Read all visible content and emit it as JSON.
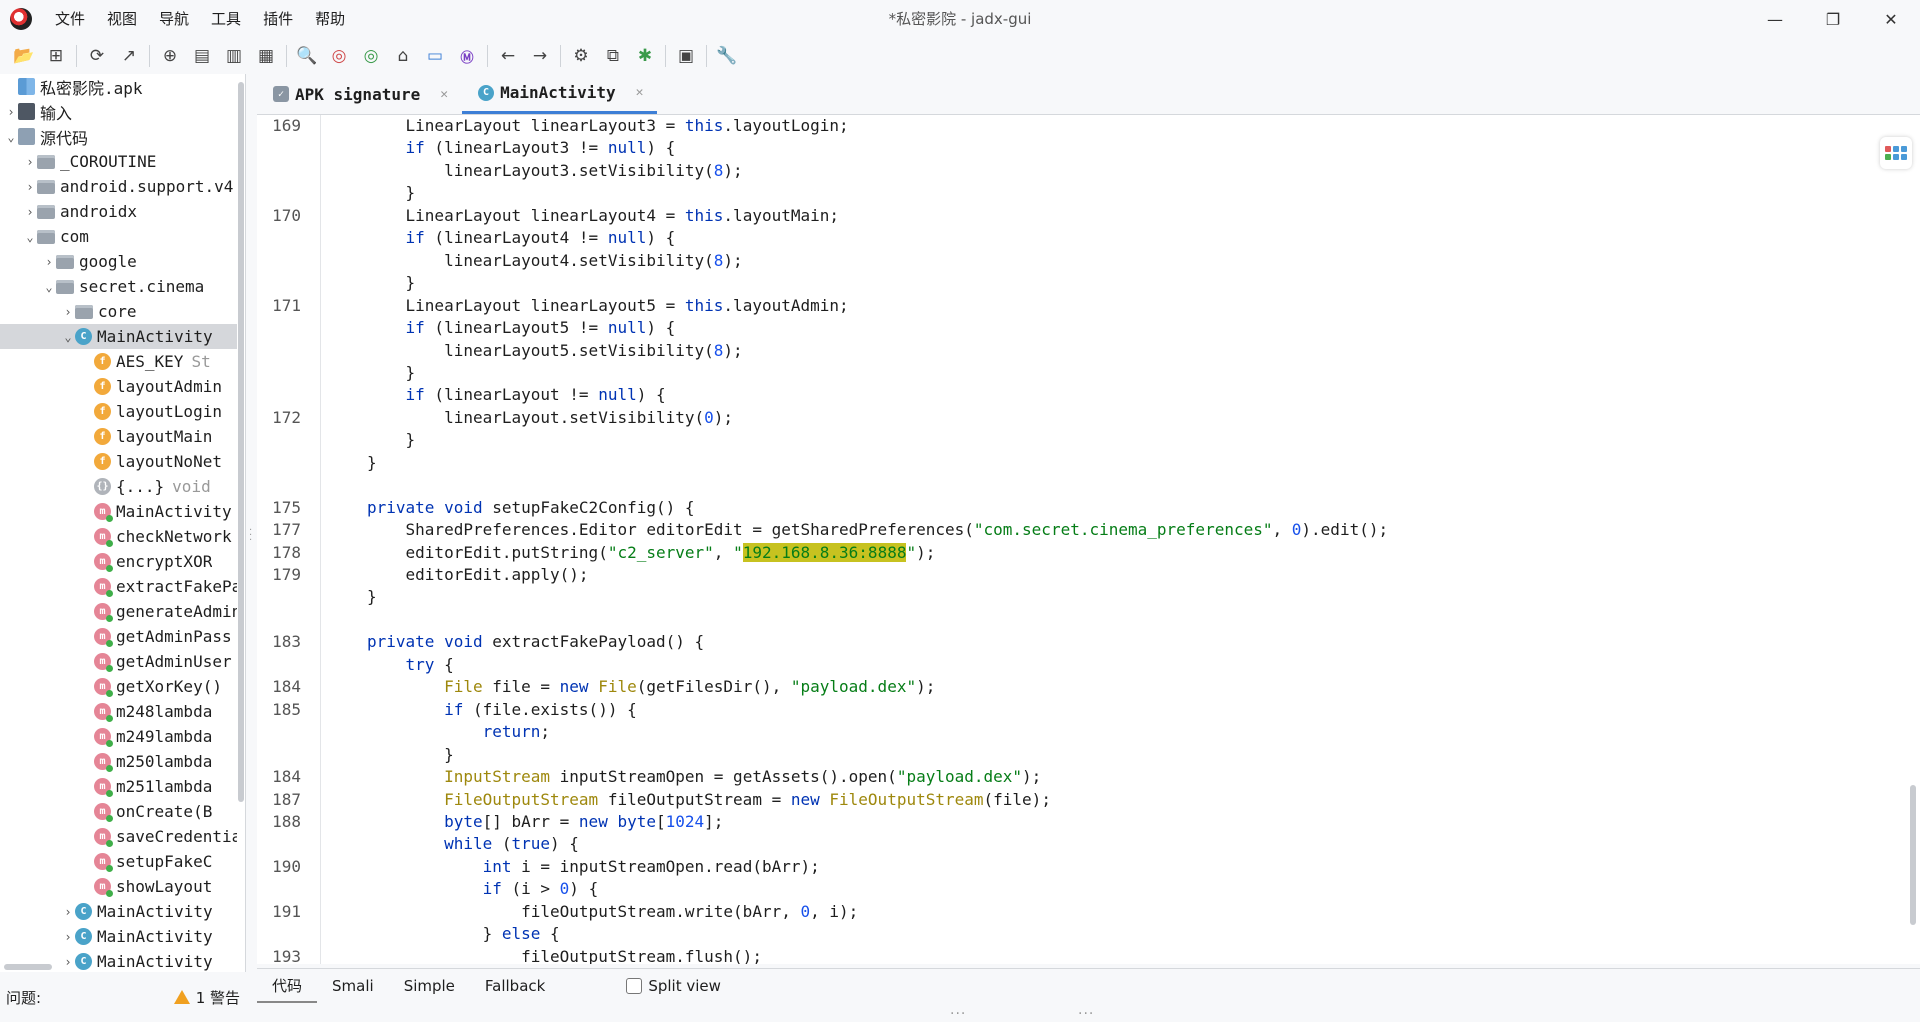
{
  "app": {
    "window_title": "*私密影院 - jadx-gui",
    "menu": [
      "文件",
      "视图",
      "导航",
      "工具",
      "插件",
      "帮助"
    ],
    "window_buttons": [
      "—",
      "❐",
      "✕"
    ]
  },
  "toolbar": {
    "icons": [
      "open-folder-icon",
      "add-files-icon",
      "reload-icon",
      "export-icon",
      "sync-tree-icon",
      "flatten-packages-icon",
      "preview-tab-icon",
      "deobfuscation-icon",
      "search-icon",
      "class-search-icon",
      "usage-search-icon",
      "home-icon",
      "log-viewer-icon",
      "smali-icon",
      "back-icon",
      "forward-icon",
      "decompile-all-icon",
      "quark-icon",
      "debugger-icon",
      "settings-dialog-icon",
      "preferences-icon"
    ]
  },
  "tree": {
    "items": [
      {
        "depth": 0,
        "chevron": "",
        "icon": "apk",
        "label": "私密影院.apk",
        "sub": ""
      },
      {
        "depth": 0,
        "chevron": "›",
        "icon": "res",
        "label": "输入",
        "sub": ""
      },
      {
        "depth": 0,
        "chevron": "⌄",
        "icon": "src",
        "label": "源代码",
        "sub": ""
      },
      {
        "depth": 1,
        "chevron": "›",
        "icon": "pkg",
        "label": "_COROUTINE",
        "sub": ""
      },
      {
        "depth": 1,
        "chevron": "›",
        "icon": "pkg",
        "label": "android.support.v4",
        "sub": ""
      },
      {
        "depth": 1,
        "chevron": "›",
        "icon": "pkg",
        "label": "androidx",
        "sub": ""
      },
      {
        "depth": 1,
        "chevron": "⌄",
        "icon": "pkg",
        "label": "com",
        "sub": ""
      },
      {
        "depth": 2,
        "chevron": "›",
        "icon": "pkg",
        "label": "google",
        "sub": ""
      },
      {
        "depth": 2,
        "chevron": "⌄",
        "icon": "pkg",
        "label": "secret.cinema",
        "sub": ""
      },
      {
        "depth": 3,
        "chevron": "›",
        "icon": "pkg",
        "label": "core",
        "sub": ""
      },
      {
        "depth": 3,
        "chevron": "⌄",
        "icon": "class",
        "label": "MainActivity",
        "sub": "",
        "selected": true
      },
      {
        "depth": 4,
        "chevron": "",
        "icon": "field",
        "label": "AES_KEY",
        "sub": "St"
      },
      {
        "depth": 4,
        "chevron": "",
        "icon": "field",
        "label": "layoutAdmin",
        "sub": ""
      },
      {
        "depth": 4,
        "chevron": "",
        "icon": "field",
        "label": "layoutLogin",
        "sub": ""
      },
      {
        "depth": 4,
        "chevron": "",
        "icon": "field",
        "label": "layoutMain",
        "sub": ""
      },
      {
        "depth": 4,
        "chevron": "",
        "icon": "field",
        "label": "layoutNoNet",
        "sub": ""
      },
      {
        "depth": 4,
        "chevron": "",
        "icon": "block",
        "label": "{...}",
        "sub": "void"
      },
      {
        "depth": 4,
        "chevron": "",
        "icon": "method",
        "label": "MainActivity",
        "sub": ""
      },
      {
        "depth": 4,
        "chevron": "",
        "icon": "method",
        "label": "checkNetwork",
        "sub": ""
      },
      {
        "depth": 4,
        "chevron": "",
        "icon": "method",
        "label": "encryptXOR",
        "sub": ""
      },
      {
        "depth": 4,
        "chevron": "",
        "icon": "method",
        "label": "extractFakePayload",
        "sub": ""
      },
      {
        "depth": 4,
        "chevron": "",
        "icon": "method",
        "label": "generateAdmin",
        "sub": ""
      },
      {
        "depth": 4,
        "chevron": "",
        "icon": "method",
        "label": "getAdminPass",
        "sub": ""
      },
      {
        "depth": 4,
        "chevron": "",
        "icon": "method",
        "label": "getAdminUser",
        "sub": ""
      },
      {
        "depth": 4,
        "chevron": "",
        "icon": "method",
        "label": "getXorKey()",
        "sub": ""
      },
      {
        "depth": 4,
        "chevron": "",
        "icon": "method",
        "label": "m248lambda",
        "sub": ""
      },
      {
        "depth": 4,
        "chevron": "",
        "icon": "method",
        "label": "m249lambda",
        "sub": ""
      },
      {
        "depth": 4,
        "chevron": "",
        "icon": "method",
        "label": "m250lambda",
        "sub": ""
      },
      {
        "depth": 4,
        "chevron": "",
        "icon": "method",
        "label": "m251lambda",
        "sub": ""
      },
      {
        "depth": 4,
        "chevron": "",
        "icon": "method",
        "label": "onCreate(B",
        "sub": ""
      },
      {
        "depth": 4,
        "chevron": "",
        "icon": "method",
        "label": "saveCredentials",
        "sub": ""
      },
      {
        "depth": 4,
        "chevron": "",
        "icon": "method",
        "label": "setupFakeC",
        "sub": ""
      },
      {
        "depth": 4,
        "chevron": "",
        "icon": "method",
        "label": "showLayout",
        "sub": ""
      },
      {
        "depth": 3,
        "chevron": "›",
        "icon": "class",
        "label": "MainActivity",
        "sub": ""
      },
      {
        "depth": 3,
        "chevron": "›",
        "icon": "class",
        "label": "MainActivity",
        "sub": ""
      },
      {
        "depth": 3,
        "chevron": "›",
        "icon": "class",
        "label": "MainActivity",
        "sub": ""
      }
    ]
  },
  "status": {
    "problems_label": "问题:",
    "warning_text": "1 警告"
  },
  "tabs": [
    {
      "label": "APK signature",
      "icon": "apk-signature-icon",
      "active": false
    },
    {
      "label": "MainActivity",
      "icon": "class-icon",
      "active": true
    }
  ],
  "code_lines": [
    {
      "ln": "169",
      "html": "    LinearLayout linearLayout3 = <span class=\"kw\">this</span>.layoutLogin;"
    },
    {
      "ln": "",
      "html": "    <span class=\"kw\">if</span> (linearLayout3 != <span class=\"kw\">null</span>) {"
    },
    {
      "ln": "",
      "html": "        linearLayout3.setVisibility(<span class=\"nm\">8</span>);"
    },
    {
      "ln": "",
      "html": "    }"
    },
    {
      "ln": "170",
      "html": "    LinearLayout linearLayout4 = <span class=\"kw\">this</span>.layoutMain;"
    },
    {
      "ln": "",
      "html": "    <span class=\"kw\">if</span> (linearLayout4 != <span class=\"kw\">null</span>) {"
    },
    {
      "ln": "",
      "html": "        linearLayout4.setVisibility(<span class=\"nm\">8</span>);"
    },
    {
      "ln": "",
      "html": "    }"
    },
    {
      "ln": "171",
      "html": "    LinearLayout linearLayout5 = <span class=\"kw\">this</span>.layoutAdmin;"
    },
    {
      "ln": "",
      "html": "    <span class=\"kw\">if</span> (linearLayout5 != <span class=\"kw\">null</span>) {"
    },
    {
      "ln": "",
      "html": "        linearLayout5.setVisibility(<span class=\"nm\">8</span>);"
    },
    {
      "ln": "",
      "html": "    }"
    },
    {
      "ln": "",
      "html": "    <span class=\"kw\">if</span> (linearLayout != <span class=\"kw\">null</span>) {"
    },
    {
      "ln": "172",
      "html": "        linearLayout.setVisibility(<span class=\"nm\">0</span>);"
    },
    {
      "ln": "",
      "html": "    }"
    },
    {
      "ln": "",
      "html": "}"
    },
    {
      "ln": "",
      "html": ""
    },
    {
      "ln": "175",
      "html": "<span class=\"kw\">private void</span> setupFakeC2Config() {"
    },
    {
      "ln": "177",
      "html": "    SharedPreferences.Editor editorEdit = getSharedPreferences(<span class=\"st\">\"com.secret.cinema_preferences\"</span>, <span class=\"nm\">0</span>).edit();"
    },
    {
      "ln": "178",
      "html": "    editorEdit.putString(<span class=\"st\">\"c2_server\"</span>, <span class=\"st\">\"<span class=\"hl\">192.168.8.36:8888</span>\"</span>);"
    },
    {
      "ln": "179",
      "html": "    editorEdit.apply();"
    },
    {
      "ln": "",
      "html": "}"
    },
    {
      "ln": "",
      "html": ""
    },
    {
      "ln": "183",
      "html": "<span class=\"kw\">private void</span> extractFakePayload() {"
    },
    {
      "ln": "",
      "html": "    <span class=\"kw\">try</span> {"
    },
    {
      "ln": "184",
      "html": "        <span class=\"ty\">File</span> file = <span class=\"kw\">new</span> <span class=\"ty\">File</span>(getFilesDir(), <span class=\"st\">\"payload.dex\"</span>);"
    },
    {
      "ln": "185",
      "html": "        <span class=\"kw\">if</span> (file.exists()) {"
    },
    {
      "ln": "",
      "html": "            <span class=\"kw\">return</span>;"
    },
    {
      "ln": "",
      "html": "        }"
    },
    {
      "ln": "184",
      "html": "        <span class=\"ty\">InputStream</span> inputStreamOpen = getAssets().open(<span class=\"st\">\"payload.dex\"</span>);"
    },
    {
      "ln": "187",
      "html": "        <span class=\"ty\">FileOutputStream</span> fileOutputStream = <span class=\"kw\">new</span> <span class=\"ty\">FileOutputStream</span>(file);"
    },
    {
      "ln": "188",
      "html": "        <span class=\"kw\">byte</span>[] bArr = <span class=\"kw\">new byte</span>[<span class=\"nm\">1024</span>];"
    },
    {
      "ln": "",
      "html": "        <span class=\"kw\">while</span> (<span class=\"kw\">true</span>) {"
    },
    {
      "ln": "190",
      "html": "            <span class=\"kw\">int</span> i = inputStreamOpen.read(bArr);"
    },
    {
      "ln": "",
      "html": "            <span class=\"kw\">if</span> (i &gt; <span class=\"nm\">0</span>) {"
    },
    {
      "ln": "191",
      "html": "                fileOutputStream.write(bArr, <span class=\"nm\">0</span>, i);"
    },
    {
      "ln": "",
      "html": "            } <span class=\"kw\">else</span> {"
    },
    {
      "ln": "193",
      "html": "                fileOutputStream.flush();"
    }
  ],
  "bottom_tabs": [
    "代码",
    "Smali",
    "Simple",
    "Fallback"
  ],
  "split_view_label": "Split view",
  "colors": {
    "keyword": "#0033b3",
    "string": "#067d17",
    "number": "#1750eb",
    "type": "#9e880d",
    "highlight": "#c7c220",
    "accent": "#3d7fd6"
  }
}
